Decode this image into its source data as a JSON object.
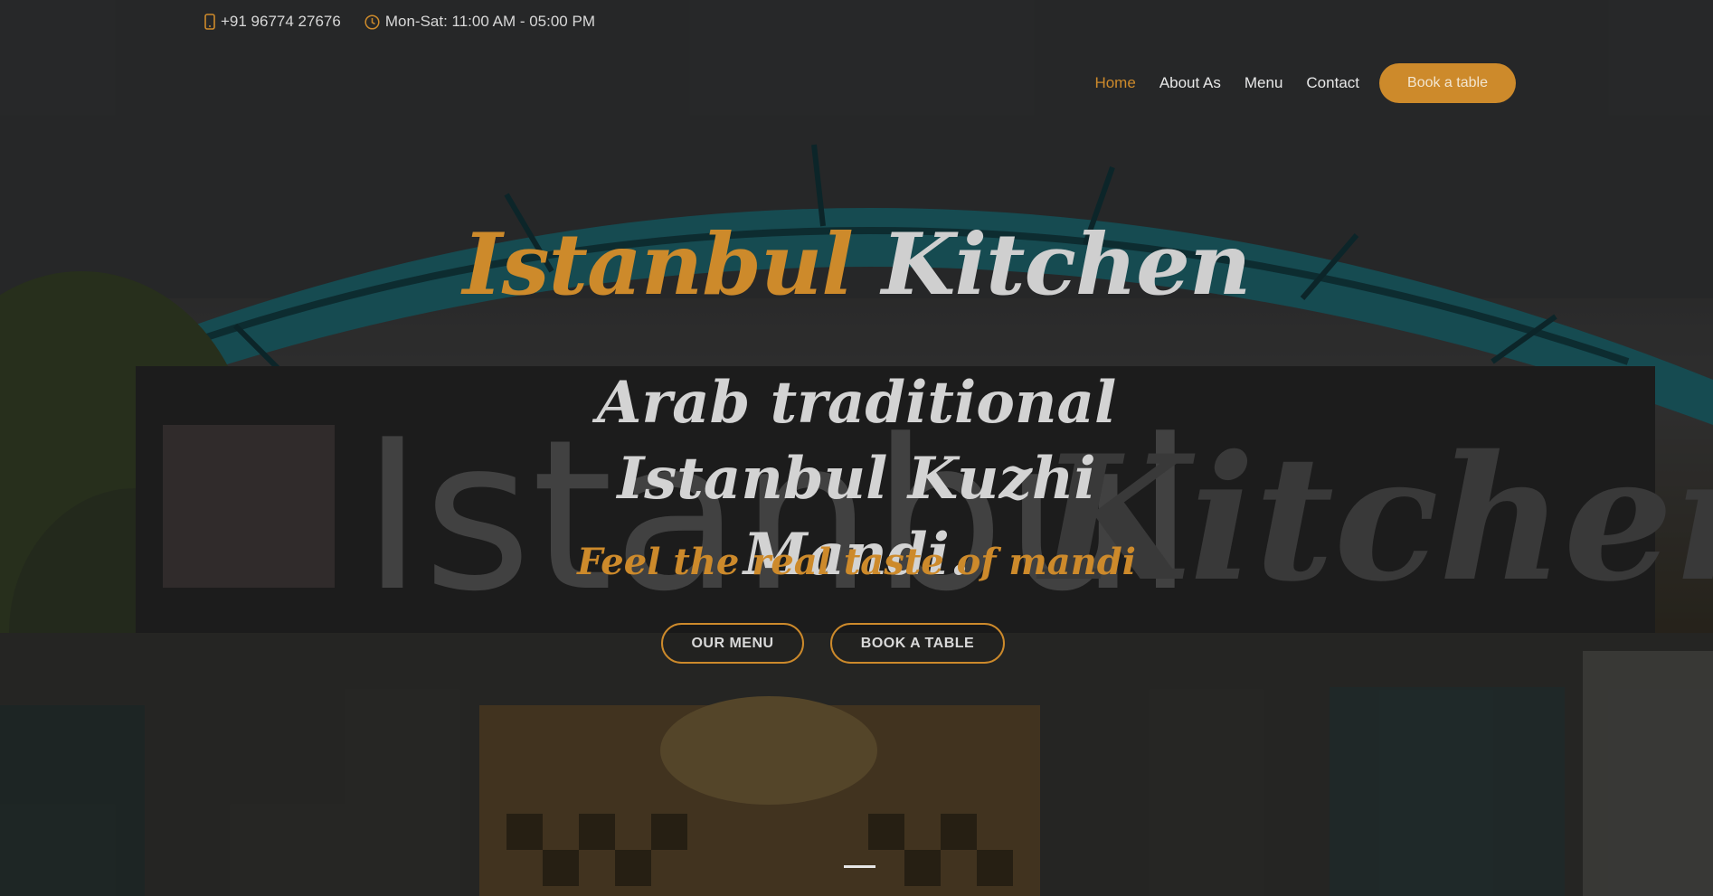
{
  "topbar": {
    "phone_icon": "mobile-phone-icon",
    "phone": "+91 96774 27676",
    "clock_icon": "clock-icon",
    "hours": "Mon-Sat: 11:00 AM - 05:00 PM"
  },
  "nav": {
    "items": [
      {
        "label": "Home",
        "active": true
      },
      {
        "label": "About As",
        "active": false
      },
      {
        "label": "Menu",
        "active": false
      },
      {
        "label": "Contact",
        "active": false
      }
    ],
    "book_label": "Book a table"
  },
  "hero": {
    "brand_first": "Istanbul",
    "brand_second": "Kitchen",
    "tagline": "Arab traditional Istanbul Kuzhi Mandi.",
    "subtagline": "Feel the real taste of mandi",
    "menu_button": "OUR MENU",
    "book_button": "BOOK A TABLE"
  },
  "colors": {
    "accent": "#cd8a2b",
    "text_light": "#d3d3d3"
  }
}
